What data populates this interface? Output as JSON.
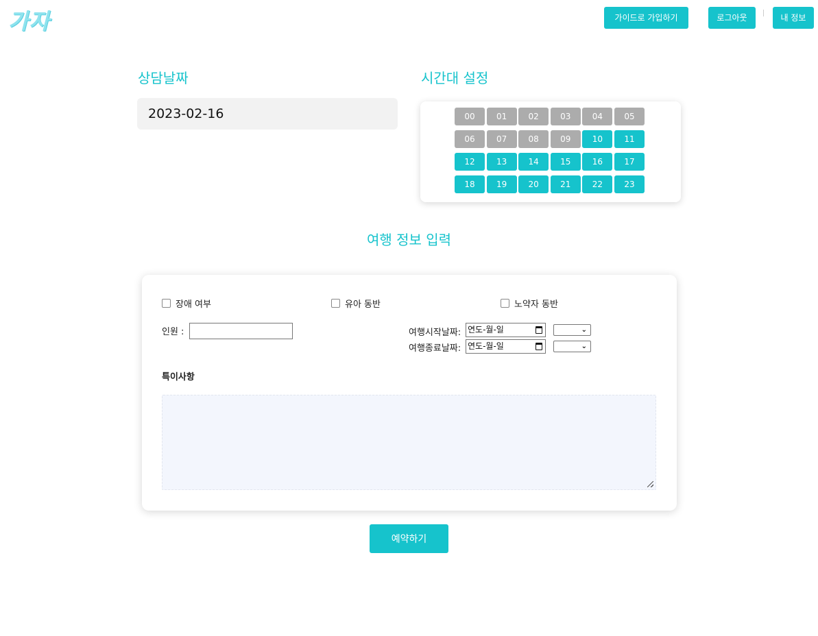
{
  "header": {
    "logo": "가자",
    "nav": {
      "signup_guide": "가이드로 가입하기",
      "logout": "로그아웃",
      "my_info": "내 정보"
    }
  },
  "consult_date": {
    "title": "상담날짜",
    "value": "2023-02-16"
  },
  "time_slots": {
    "title": "시간대 설정",
    "slots": [
      {
        "label": "00",
        "available": false
      },
      {
        "label": "01",
        "available": false
      },
      {
        "label": "02",
        "available": false
      },
      {
        "label": "03",
        "available": false
      },
      {
        "label": "04",
        "available": false
      },
      {
        "label": "05",
        "available": false
      },
      {
        "label": "06",
        "available": false
      },
      {
        "label": "07",
        "available": false
      },
      {
        "label": "08",
        "available": false
      },
      {
        "label": "09",
        "available": false
      },
      {
        "label": "10",
        "available": true
      },
      {
        "label": "11",
        "available": true
      },
      {
        "label": "12",
        "available": true
      },
      {
        "label": "13",
        "available": true
      },
      {
        "label": "14",
        "available": true
      },
      {
        "label": "15",
        "available": true
      },
      {
        "label": "16",
        "available": true
      },
      {
        "label": "17",
        "available": true
      },
      {
        "label": "18",
        "available": true
      },
      {
        "label": "19",
        "available": true
      },
      {
        "label": "20",
        "available": true
      },
      {
        "label": "21",
        "available": true
      },
      {
        "label": "22",
        "available": true
      },
      {
        "label": "23",
        "available": true
      }
    ],
    "colors": {
      "available": "#16c3cc",
      "unavailable": "#acacac"
    }
  },
  "travel_info": {
    "title": "여행 정보 입력",
    "checkboxes": {
      "disability": "장애 여부",
      "infant": "유아 동반",
      "elderly": "노약자 동반"
    },
    "people_label": "인원 :",
    "people_value": "",
    "start_date_label": "여행시작날짜:",
    "start_date_placeholder": "연도-월-일",
    "end_date_label": "여행종료날짜:",
    "end_date_placeholder": "연도-월-일",
    "notes_label": "특이사항",
    "notes_value": ""
  },
  "submit_label": "예약하기",
  "accent_color": "#16c3cc"
}
